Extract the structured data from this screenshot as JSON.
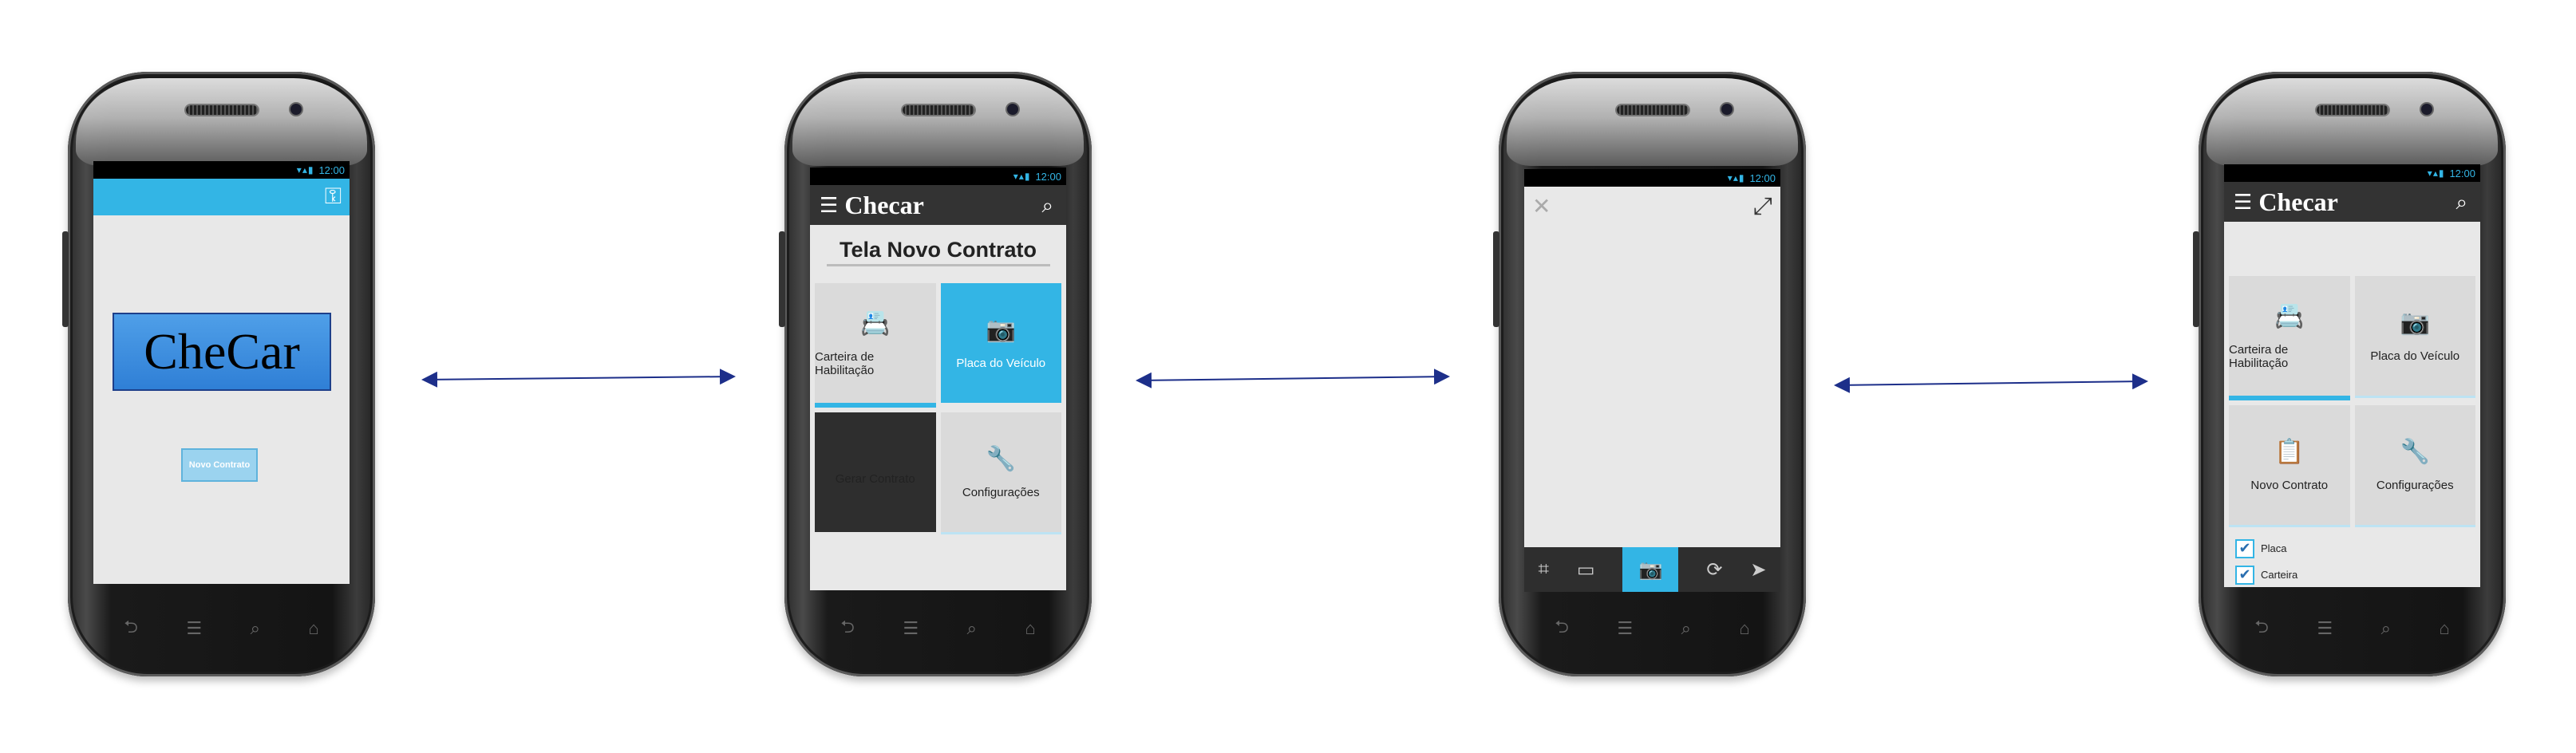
{
  "status": {
    "time": "12:00",
    "icons": "▾▴▮"
  },
  "nav": {
    "back": "⮌",
    "home": "⌂",
    "recent": "☰",
    "search": "⌕"
  },
  "screen1": {
    "logo": "CheCar",
    "button": "Novo Contrato",
    "icon": "settings-key-icon"
  },
  "screen2": {
    "app_title": "Checar",
    "page_title": "Tela Novo Contrato",
    "tiles": [
      {
        "label": "Carteira de Habilitação",
        "icon": "📇"
      },
      {
        "label": "Placa do Veículo",
        "icon": "📷"
      },
      {
        "label": "Gerar Contrato",
        "icon": ""
      },
      {
        "label": "Configurações",
        "icon": "🔧"
      }
    ]
  },
  "screen3": {
    "close": "✕",
    "expand": "⤢",
    "toolbar": [
      "⌗",
      "▭",
      "📷",
      "⟳",
      "➤"
    ]
  },
  "screen4": {
    "app_title": "Checar",
    "tiles": [
      {
        "label": "Carteira de Habilitação",
        "icon": "📇"
      },
      {
        "label": "Placa do Veículo",
        "icon": "📷"
      },
      {
        "label": "Novo Contrato",
        "icon": "📋"
      },
      {
        "label": "Configurações",
        "icon": "🔧"
      }
    ],
    "checks": [
      {
        "label": "Placa",
        "checked": "✔"
      },
      {
        "label": "Carteira",
        "checked": "✔"
      }
    ]
  },
  "colors": {
    "accent": "#33b5e5",
    "arrow": "#1d2f8a",
    "actionbar": "#333333"
  }
}
